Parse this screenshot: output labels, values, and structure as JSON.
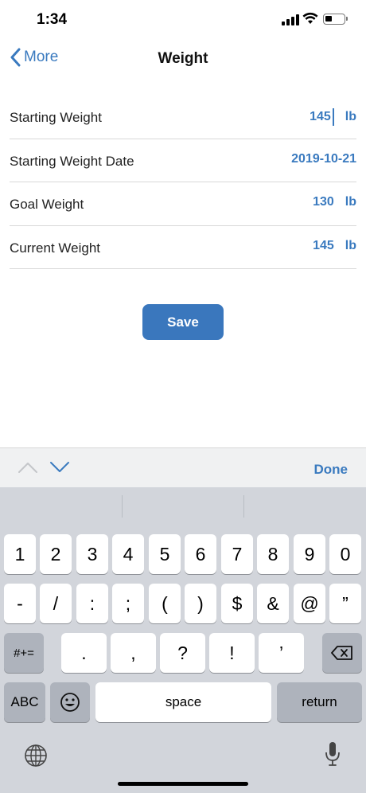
{
  "status": {
    "time": "1:34"
  },
  "nav": {
    "back_label": "More",
    "title": "Weight"
  },
  "form": {
    "rows": [
      {
        "label": "Starting Weight",
        "value": "145",
        "unit": "lb"
      },
      {
        "label": "Starting Weight Date",
        "value": "2019-10-21"
      },
      {
        "label": "Goal Weight",
        "value": "130",
        "unit": "lb"
      },
      {
        "label": "Current Weight",
        "value": "145",
        "unit": "lb"
      }
    ],
    "save_label": "Save"
  },
  "accessory": {
    "done_label": "Done"
  },
  "keyboard": {
    "row1": [
      "1",
      "2",
      "3",
      "4",
      "5",
      "6",
      "7",
      "8",
      "9",
      "0"
    ],
    "row2": [
      "-",
      "/",
      ":",
      ";",
      "(",
      ")",
      "$",
      "&",
      "@",
      "”"
    ],
    "row3": [
      "#+=",
      ".",
      ",",
      "?",
      "!",
      "’"
    ],
    "row4": [
      "ABC",
      "space",
      "return"
    ]
  },
  "colors": {
    "accent": "#3a7abf",
    "button": "#3a77bd",
    "keyboard_bg": "#d2d5db"
  }
}
